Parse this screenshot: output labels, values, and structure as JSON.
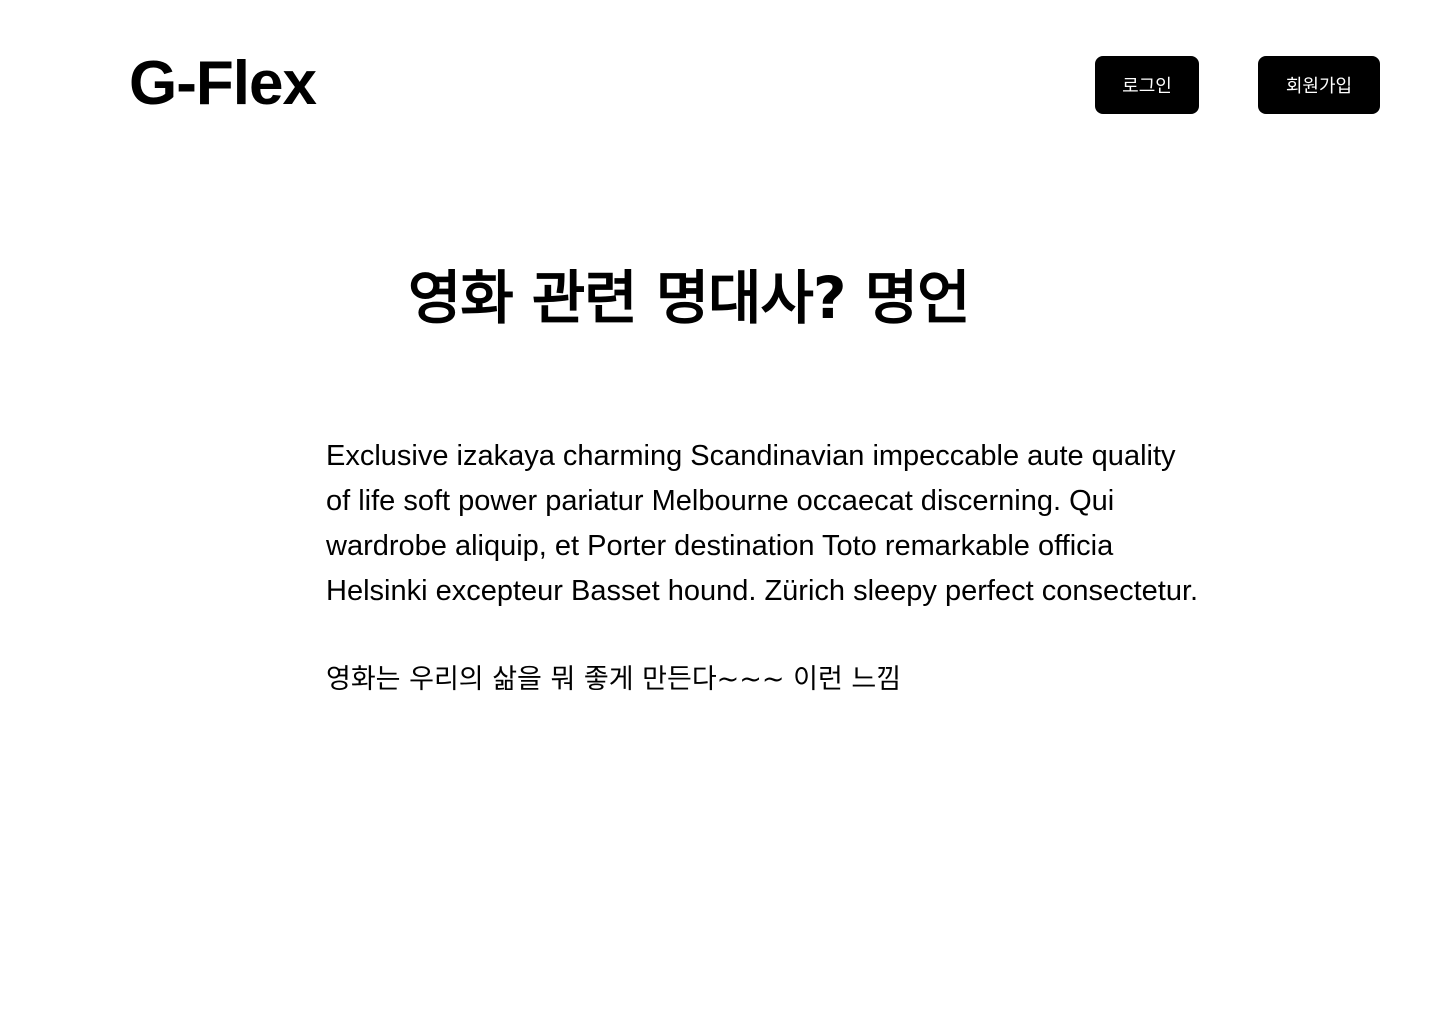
{
  "header": {
    "logo": "G-Flex",
    "login_label": "로그인",
    "signup_label": "회원가입"
  },
  "main": {
    "title": "영화 관련 명대사? 명언",
    "paragraph": "Exclusive izakaya charming Scandinavian impeccable aute quality of life soft power pariatur Melbourne occaecat discerning. Qui wardrobe aliquip, et Porter destination Toto remarkable officia Helsinki excepteur Basset hound. Zürich sleepy perfect consectetur.",
    "paragraph_ko": "영화는 우리의 삶을 뭐 좋게 만든다~~~ 이런 느낌"
  },
  "colors": {
    "background": "#ffffff",
    "text": "#000000",
    "button_bg": "#000000",
    "button_text": "#ffffff"
  }
}
